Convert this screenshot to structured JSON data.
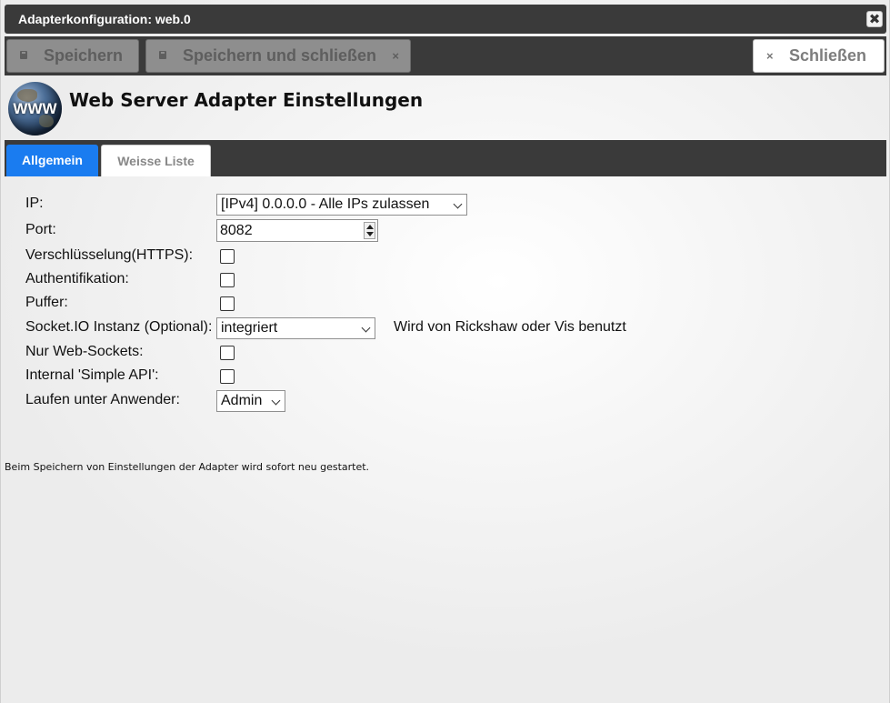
{
  "window": {
    "title": "Adapterkonfiguration: web.0",
    "close_glyph": "✖"
  },
  "toolbar": {
    "save_label": "Speichern",
    "save_close_label": "Speichern und schließen",
    "save_close_dismiss_glyph": "×",
    "close_label": "Schließen",
    "close_glyph": "×"
  },
  "header": {
    "logo_text": "WWW",
    "title": "Web Server Adapter Einstellungen"
  },
  "tabs": [
    {
      "label": "Allgemein",
      "active": true
    },
    {
      "label": "Weisse Liste",
      "active": false
    }
  ],
  "form": {
    "ip": {
      "label": "IP:",
      "value": "[IPv4] 0.0.0.0 - Alle IPs zulassen"
    },
    "port": {
      "label": "Port:",
      "value": "8082"
    },
    "https": {
      "label": "Verschlüsselung(HTTPS):",
      "checked": false
    },
    "auth": {
      "label": "Authentifikation:",
      "checked": false
    },
    "cache": {
      "label": "Puffer:",
      "checked": false
    },
    "socketio": {
      "label": "Socket.IO Instanz (Optional):",
      "value": "integriert",
      "hint": "Wird von Rickshaw oder Vis benutzt"
    },
    "websockets": {
      "label": "Nur Web-Sockets:",
      "checked": false
    },
    "simpleapi": {
      "label": "Internal 'Simple API':",
      "checked": false
    },
    "user": {
      "label": "Laufen unter Anwender:",
      "value": "Admin"
    }
  },
  "footer": {
    "note": "Beim Speichern von Einstellungen der Adapter wird sofort neu gestartet."
  },
  "colors": {
    "bar": "#3a3a3a",
    "active_tab": "#1a7cf0"
  }
}
